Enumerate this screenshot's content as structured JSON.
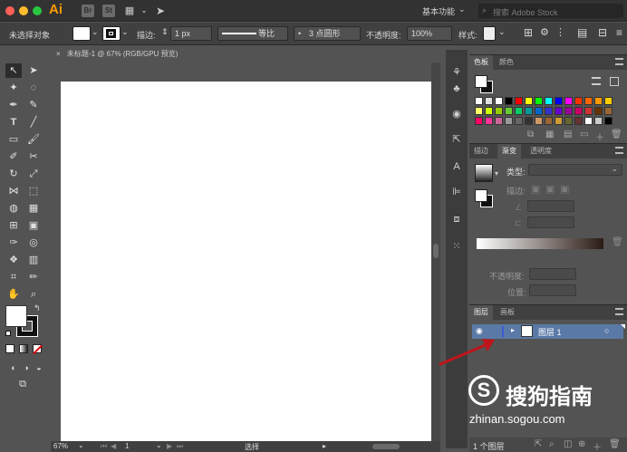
{
  "titlebar": {
    "app_logo": "Ai",
    "st_label": "St",
    "workspace": "基本功能",
    "search_placeholder": "搜索 Adobe Stock"
  },
  "controlbar": {
    "selection": "未选择对象",
    "stroke_label": "描边:",
    "stroke_value": "1 px",
    "profile": "等比",
    "brush": "3 点圆形",
    "opacity_label": "不透明度:",
    "opacity_value": "100%",
    "style_label": "样式:"
  },
  "document": {
    "tab_title": "未标题-1 @ 67% (RGB/GPU 预览)",
    "zoom": "67%",
    "page": "1",
    "status": "选择"
  },
  "panels": {
    "swatches_tabs": [
      "色板",
      "颜色"
    ],
    "gradient_tabs": [
      "描边",
      "渐变",
      "透明度"
    ],
    "gradient_type_label": "类型:",
    "gradient_stroke_label": "描边:",
    "opacity_label": "不透明度:",
    "position_label": "位置:",
    "layers_tabs": [
      "图层",
      "画板"
    ],
    "layer_name": "图层 1",
    "layer_count": "1 个图层"
  },
  "watermark": {
    "brand": "搜狗指南",
    "url": "zhinan.sogou.com"
  },
  "colors": {
    "bg": "#535353",
    "titlebar": "#323232",
    "accent_ai": "#ff9a00",
    "layer_highlight": "#5a79a6",
    "arrow": "#c0141c"
  }
}
